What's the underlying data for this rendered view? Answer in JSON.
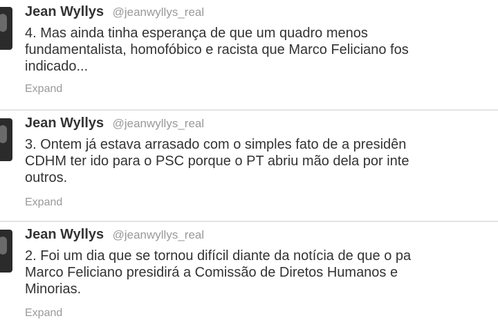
{
  "tweets": [
    {
      "fullname": "Jean Wyllys",
      "username": "@jeanwyllys_real",
      "lines": [
        "4. Mas ainda tinha esperança de que um quadro menos",
        "fundamentalista, homofóbico e racista que Marco Feliciano fos",
        "indicado..."
      ],
      "expand_label": "Expand"
    },
    {
      "fullname": "Jean Wyllys",
      "username": "@jeanwyllys_real",
      "lines": [
        "3. Ontem já estava arrasado com o simples fato de a presidên",
        "CDHM ter ido para o PSC porque o PT abriu mão dela por inte",
        "outros."
      ],
      "expand_label": "Expand"
    },
    {
      "fullname": "Jean Wyllys",
      "username": "@jeanwyllys_real",
      "lines": [
        "2. Foi um dia que se tornou difícil diante da notícia de que o pa",
        "Marco Feliciano presidirá a Comissão de Diretos Humanos e",
        "Minorias."
      ],
      "expand_label": "Expand"
    }
  ]
}
